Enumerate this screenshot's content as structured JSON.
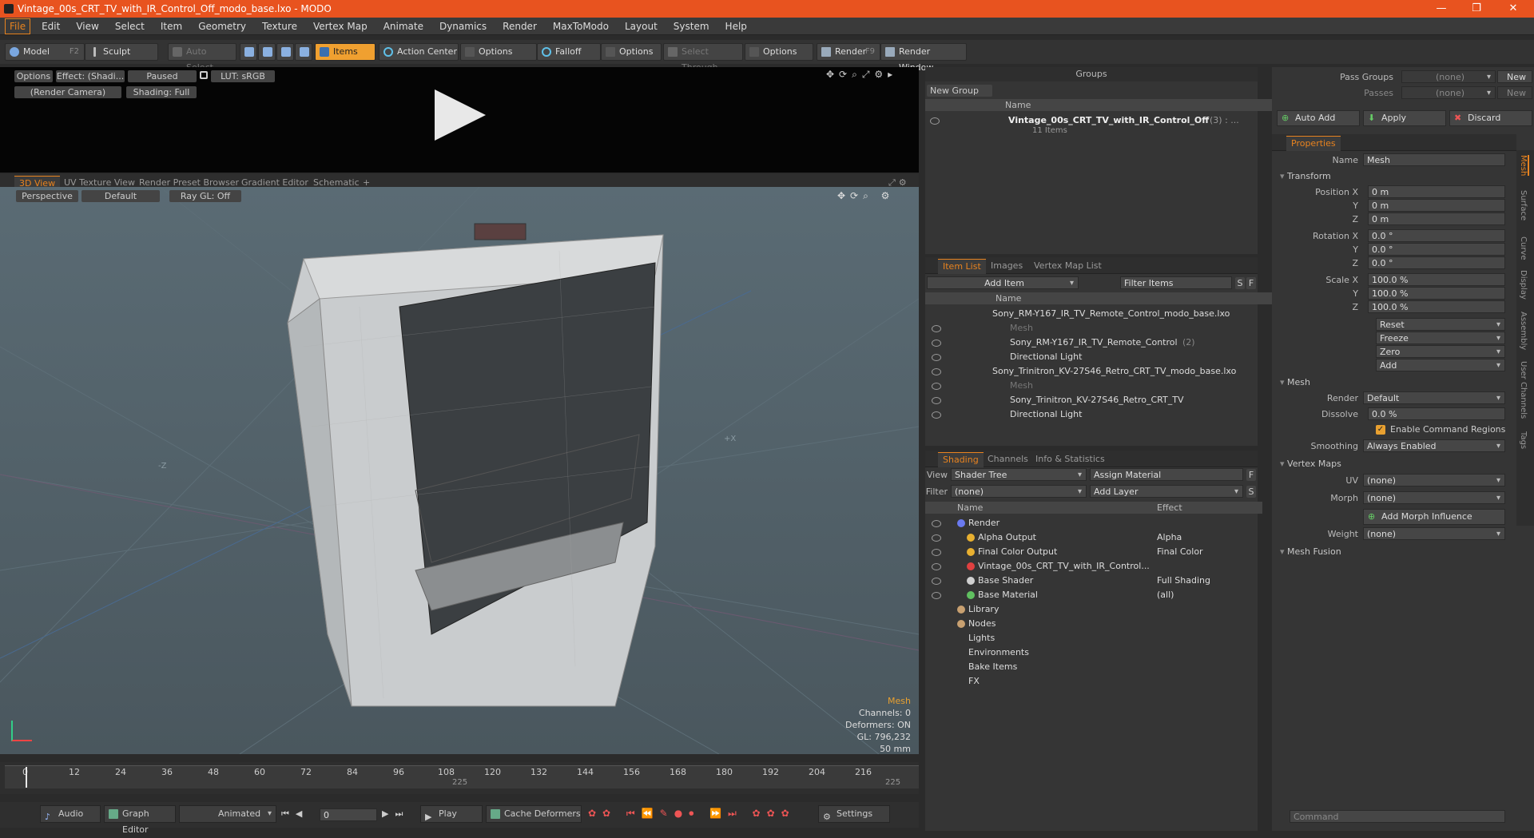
{
  "window": {
    "title": "Vintage_00s_CRT_TV_with_IR_Control_Off_modo_base.lxo - MODO"
  },
  "menu": [
    "File",
    "Edit",
    "View",
    "Select",
    "Item",
    "Geometry",
    "Texture",
    "Vertex Map",
    "Animate",
    "Dynamics",
    "Render",
    "MaxToModo",
    "Layout",
    "System",
    "Help"
  ],
  "toolbar": {
    "model": "Model",
    "model_key": "F2",
    "sculpt": "Sculpt",
    "auto_select": "Auto Select",
    "items": "Items",
    "action_center": "Action Center",
    "options1": "Options",
    "falloff": "Falloff",
    "options2": "Options",
    "select_through": "Select Through",
    "options3": "Options",
    "render": "Render",
    "render_key": "F9",
    "render_window": "Render Window"
  },
  "preview": {
    "options": "Options",
    "effect": "Effect: (Shadi...",
    "paused": "Paused",
    "lut": "LUT: sRGB",
    "camera": "(Render Camera)",
    "shading": "Shading: Full"
  },
  "viewtabs": [
    "3D View",
    "UV Texture View",
    "Render Preset Browser",
    "Gradient Editor",
    "Schematic"
  ],
  "viewport": {
    "perspective": "Perspective",
    "default": "Default",
    "raygl": "Ray GL: Off",
    "axis_x": "+X",
    "axis_z": "-Z",
    "stats": {
      "title": "Mesh",
      "channels": "Channels: 0",
      "deformers": "Deformers: ON",
      "gl": "GL: 796,232",
      "focal": "50 mm"
    }
  },
  "timeline": {
    "ticks": [
      "0",
      "12",
      "24",
      "36",
      "48",
      "60",
      "72",
      "84",
      "96",
      "108",
      "120",
      "132",
      "144",
      "156",
      "168",
      "180",
      "192",
      "204",
      "216"
    ],
    "marker_mid": "225",
    "marker_end": "225"
  },
  "bottom": {
    "audio": "Audio",
    "graph_editor": "Graph Editor",
    "animated": "Animated",
    "frame": "0",
    "play": "Play",
    "cache": "Cache Deformers",
    "settings": "Settings"
  },
  "groups": {
    "title": "Groups",
    "new_group": "New Group",
    "col_name": "Name",
    "item_name": "Vintage_00s_CRT_TV_with_IR_Control_Off",
    "item_count": "(3) : ...",
    "item_sub": "11 Items"
  },
  "itemlist": {
    "tabs": [
      "Item List",
      "Images",
      "Vertex Map List"
    ],
    "add_item": "Add Item",
    "filter": "Filter Items",
    "s": "S",
    "f": "F",
    "col_name": "Name",
    "rows": [
      {
        "label": "Sony_RM-Y167_IR_TV_Remote_Control_modo_base.lxo",
        "indent": 0,
        "dim": false
      },
      {
        "label": "Mesh",
        "indent": 1,
        "dim": true
      },
      {
        "label": "Sony_RM-Y167_IR_TV_Remote_Control",
        "count": "(2)",
        "indent": 1,
        "dim": false
      },
      {
        "label": "Directional Light",
        "indent": 1,
        "dim": false
      },
      {
        "label": "Sony_Trinitron_KV-27S46_Retro_CRT_TV_modo_base.lxo",
        "indent": 0,
        "dim": false
      },
      {
        "label": "Mesh",
        "indent": 1,
        "dim": true
      },
      {
        "label": "Sony_Trinitron_KV-27S46_Retro_CRT_TV",
        "indent": 1,
        "dim": false
      },
      {
        "label": "Directional Light",
        "indent": 1,
        "dim": false
      }
    ]
  },
  "shading": {
    "tabs": [
      "Shading",
      "Channels",
      "Info & Statistics"
    ],
    "view_label": "View",
    "view_value": "Shader Tree",
    "assign": "Assign Material",
    "f": "F",
    "filter_label": "Filter",
    "filter_value": "(none)",
    "add_layer": "Add Layer",
    "s": "S",
    "col_name": "Name",
    "col_effect": "Effect",
    "rows": [
      {
        "label": "Render",
        "effect": "",
        "indent": 0
      },
      {
        "label": "Alpha Output",
        "effect": "Alpha",
        "indent": 1
      },
      {
        "label": "Final Color Output",
        "effect": "Final Color",
        "indent": 1
      },
      {
        "label": "Vintage_00s_CRT_TV_with_IR_Control...",
        "effect": "",
        "indent": 1
      },
      {
        "label": "Base Shader",
        "effect": "Full Shading",
        "indent": 1
      },
      {
        "label": "Base Material",
        "effect": "(all)",
        "indent": 1
      },
      {
        "label": "Library",
        "effect": "",
        "indent": 0
      },
      {
        "label": "Nodes",
        "effect": "",
        "indent": 0
      },
      {
        "label": "Lights",
        "effect": "",
        "indent": 0
      },
      {
        "label": "Environments",
        "effect": "",
        "indent": 0
      },
      {
        "label": "Bake Items",
        "effect": "",
        "indent": 0
      },
      {
        "label": "FX",
        "effect": "",
        "indent": 0
      }
    ]
  },
  "props": {
    "pass_groups": "Pass Groups",
    "pass_groups_val": "(none)",
    "new": "New",
    "passes": "Passes",
    "passes_val": "(none)",
    "new2": "New",
    "auto_add": "Auto Add",
    "apply": "Apply",
    "discard": "Discard",
    "tab": "Properties",
    "name_label": "Name",
    "name_value": "Mesh",
    "transform": "Transform",
    "position_x": "Position X",
    "y": "Y",
    "z": "Z",
    "pos": [
      "0 m",
      "0 m",
      "0 m"
    ],
    "rotation_x": "Rotation X",
    "rot": [
      "0.0 °",
      "0.0 °",
      "0.0 °"
    ],
    "scale_x": "Scale X",
    "scale": [
      "100.0 %",
      "100.0 %",
      "100.0 %"
    ],
    "reset": "Reset",
    "freeze": "Freeze",
    "zero": "Zero",
    "add": "Add",
    "mesh": "Mesh",
    "render_label": "Render",
    "render_val": "Default",
    "dissolve_label": "Dissolve",
    "dissolve_val": "0.0 %",
    "enable_cmd": "Enable Command Regions",
    "smoothing_label": "Smoothing",
    "smoothing_val": "Always Enabled",
    "vertex_maps": "Vertex Maps",
    "uv_label": "UV",
    "uv_val": "(none)",
    "morph_label": "Morph",
    "morph_val": "(none)",
    "add_morph": "Add Morph Influence",
    "weight_label": "Weight",
    "weight_val": "(none)",
    "mesh_fusion": "Mesh Fusion",
    "side_tabs": [
      "Mesh",
      "Surface",
      "Curve",
      "Display",
      "Assembly",
      "User Channels",
      "Tags"
    ],
    "command": "Command"
  }
}
